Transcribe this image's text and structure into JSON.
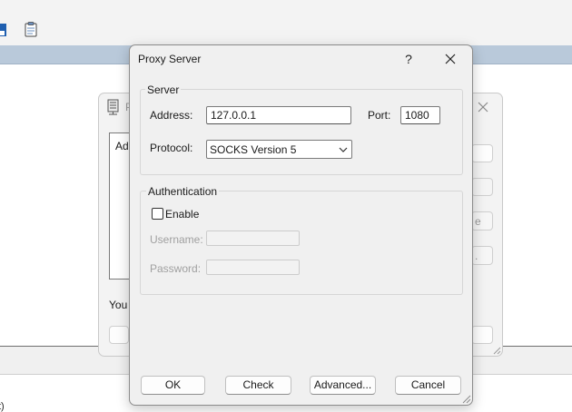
{
  "dialog": {
    "title": "Proxy Server",
    "help_label": "?",
    "server_group_label": "Server",
    "address_label": "Address:",
    "address_value": "127.0.0.1",
    "port_label": "Port:",
    "port_value": "1080",
    "protocol_label": "Protocol:",
    "protocol_value": "SOCKS Version 5",
    "auth_group_label": "Authentication",
    "enable_label": "Enable",
    "enable_checked": false,
    "username_label": "Username:",
    "password_label": "Password:",
    "buttons": {
      "ok": "OK",
      "check": "Check",
      "advanced": "Advanced...",
      "cancel": "Cancel"
    }
  },
  "background_dialog": {
    "title_fragment": "P",
    "list_fragment": "Add",
    "note_fragment": "You c",
    "button_fragment_1": "e",
    "button_fragment_2": "."
  },
  "background_app": {
    "status_fragment": "t)"
  },
  "colors": {
    "accent_band": "#b9c9da",
    "dialog_bg": "#f0f0f0"
  }
}
